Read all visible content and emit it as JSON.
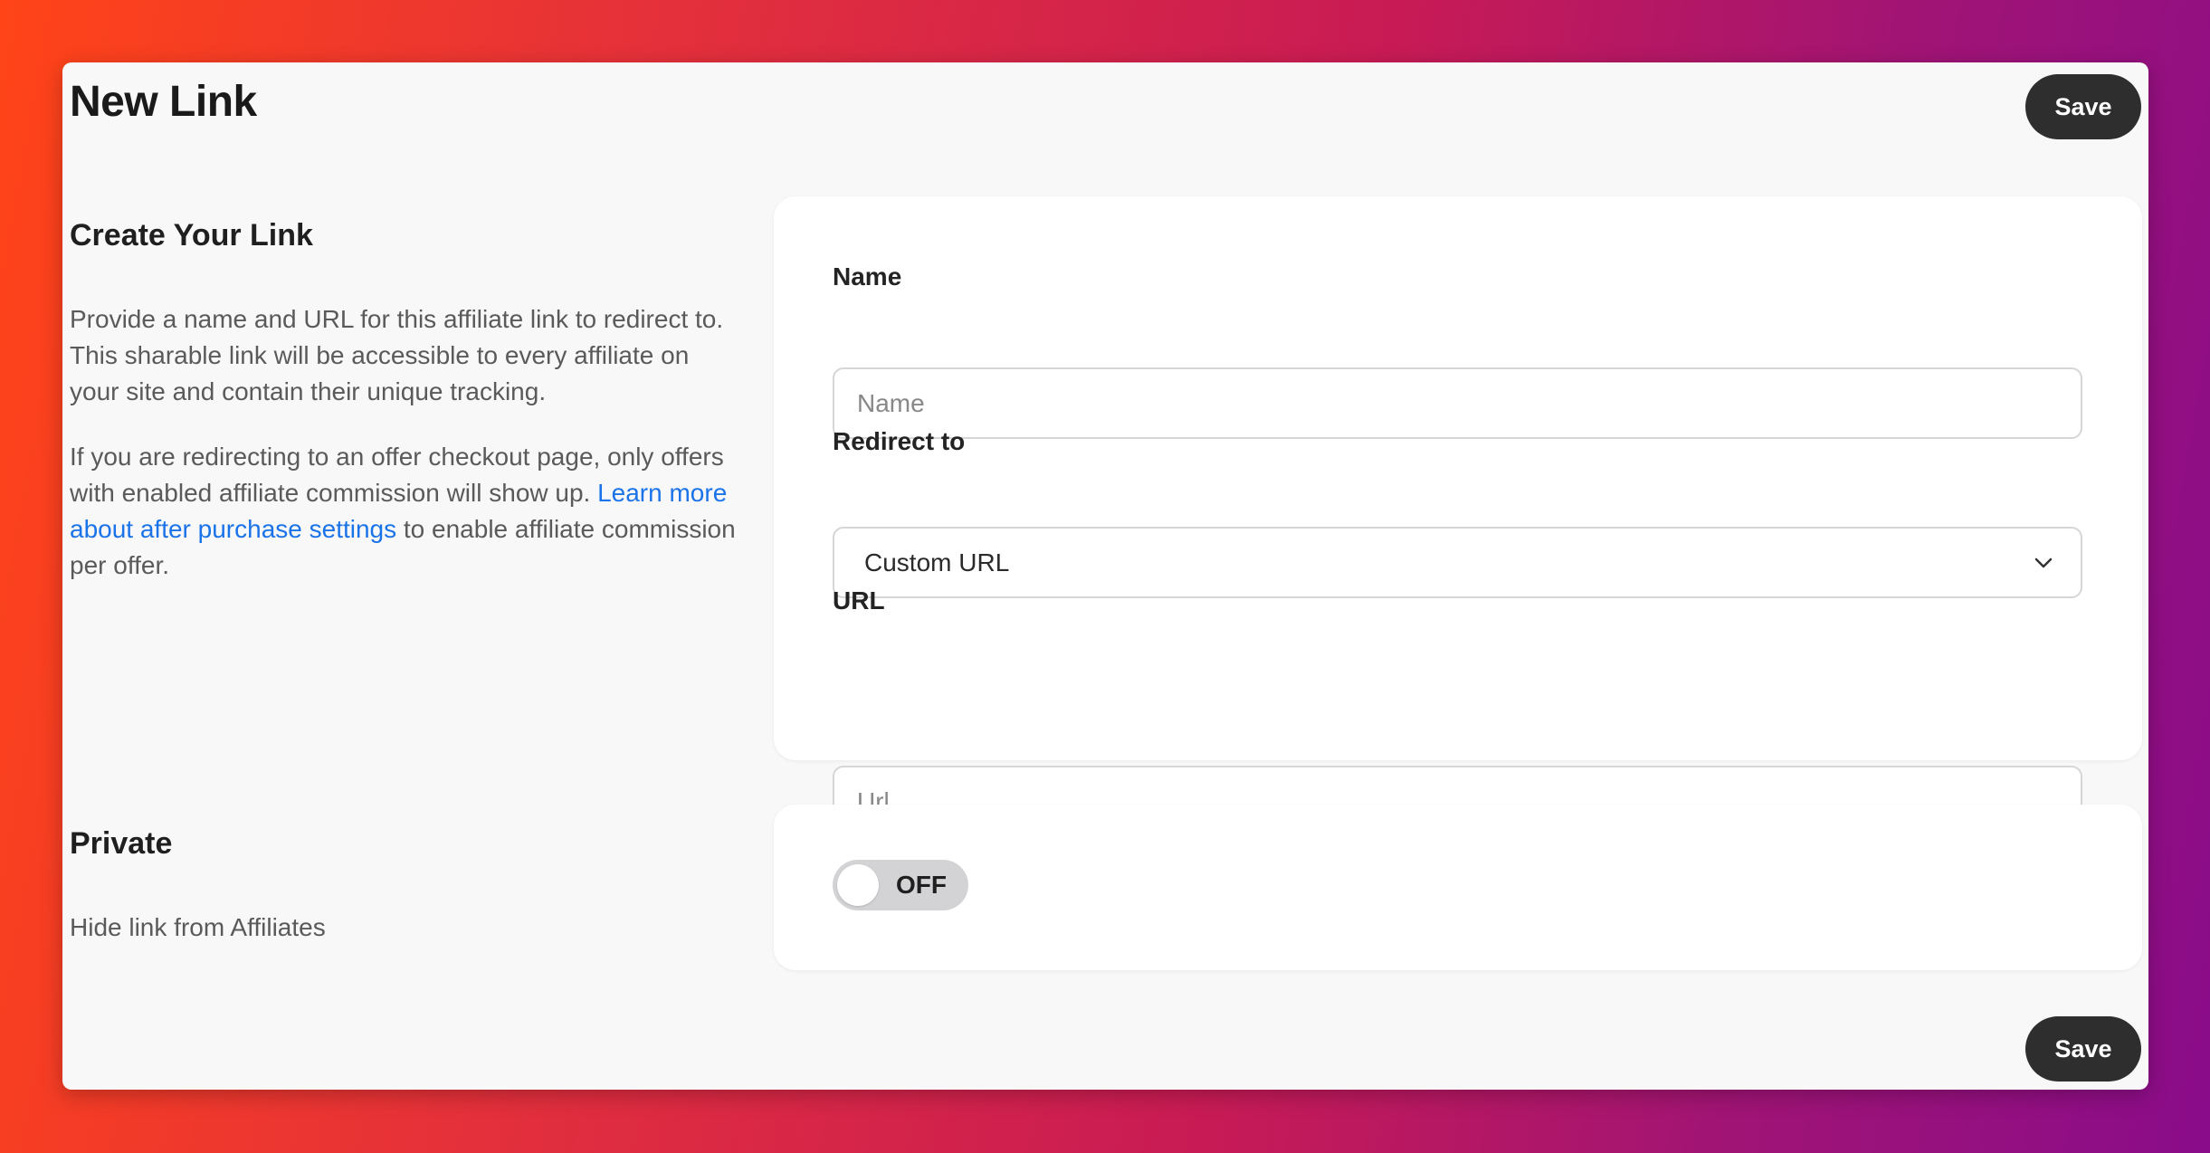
{
  "header": {
    "title": "New Link",
    "save_label": "Save"
  },
  "create_section": {
    "heading": "Create Your Link",
    "description_1": "Provide a name and URL for this affiliate link to redirect to. This sharable link will be accessible to every affiliate on your site and contain their unique tracking.",
    "description_2_before": "If you are redirecting to an offer checkout page, only offers with enabled affiliate commission will show up. ",
    "description_2_link": "Learn more about after purchase settings",
    "description_2_after": " to enable affiliate commission per offer."
  },
  "form": {
    "name_label": "Name",
    "name_placeholder": "Name",
    "redirect_label": "Redirect to",
    "redirect_value": "Custom URL",
    "url_label": "URL",
    "url_placeholder": "Url"
  },
  "private_section": {
    "heading": "Private",
    "description": "Hide link from Affiliates",
    "toggle_label": "OFF"
  },
  "footer": {
    "save_label": "Save"
  },
  "colors": {
    "accent_link": "#1a73e8",
    "button_bg": "#2e2e2e",
    "toggle_off": "#d3d3d6"
  },
  "icons": {
    "select_chevron": "chevron-down-icon"
  }
}
